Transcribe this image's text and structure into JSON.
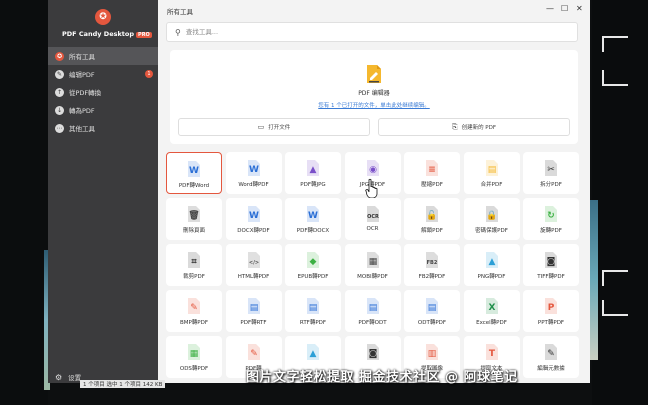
{
  "window": {
    "title": "所有工具"
  },
  "brand": {
    "name": "PDF Candy Desktop",
    "badge": "PRO"
  },
  "sidebar": {
    "items": [
      {
        "label": "所有工具",
        "icon": "brand-icon",
        "active": true
      },
      {
        "label": "编辑PDF",
        "icon": "edit-icon",
        "badge": "1"
      },
      {
        "label": "從PDF轉換",
        "icon": "convert-from-icon"
      },
      {
        "label": "轉為PDF",
        "icon": "convert-to-icon"
      },
      {
        "label": "其他工具",
        "icon": "more-icon"
      }
    ],
    "settings_label": "设置"
  },
  "search": {
    "placeholder": "查找工具..."
  },
  "editor": {
    "title": "PDF 编辑器",
    "link": "您有 1 个已打开的文件，单击此处继续编辑。",
    "open_label": "打开文件",
    "create_label": "创建新的 PDF"
  },
  "tools": [
    {
      "label": "PDF轉Word",
      "icon": "word",
      "selected": true
    },
    {
      "label": "Word轉PDF",
      "icon": "word"
    },
    {
      "label": "PDF轉JPG",
      "icon": "jpg"
    },
    {
      "label": "JPG轉PDF",
      "icon": "jpg2"
    },
    {
      "label": "壓縮PDF",
      "icon": "compress"
    },
    {
      "label": "合并PDF",
      "icon": "merge"
    },
    {
      "label": "拆分PDF",
      "icon": "scissors"
    },
    {
      "label": "刪除頁面",
      "icon": "trash"
    },
    {
      "label": "DOCX轉PDF",
      "icon": "word"
    },
    {
      "label": "PDF轉DOCX",
      "icon": "word"
    },
    {
      "label": "OCR",
      "icon": "ocr"
    },
    {
      "label": "解鎖PDF",
      "icon": "unlock"
    },
    {
      "label": "密碼保護PDF",
      "icon": "lock"
    },
    {
      "label": "旋轉PDF",
      "icon": "rotate"
    },
    {
      "label": "裁剪PDF",
      "icon": "crop"
    },
    {
      "label": "HTML轉PDF",
      "icon": "html"
    },
    {
      "label": "EPUB轉PDF",
      "icon": "epub"
    },
    {
      "label": "MOBI轉PDF",
      "icon": "mobi"
    },
    {
      "label": "FB2轉PDF",
      "icon": "fb2"
    },
    {
      "label": "PNG轉PDF",
      "icon": "png"
    },
    {
      "label": "TIFF轉PDF",
      "icon": "tiff"
    },
    {
      "label": "BMP轉PDF",
      "icon": "bmp"
    },
    {
      "label": "PDF轉RTF",
      "icon": "rtf"
    },
    {
      "label": "RTF轉PDF",
      "icon": "rtf"
    },
    {
      "label": "PDF轉ODT",
      "icon": "odt"
    },
    {
      "label": "ODT轉PDF",
      "icon": "odt"
    },
    {
      "label": "Excel轉PDF",
      "icon": "excel"
    },
    {
      "label": "PPT轉PDF",
      "icon": "ppt"
    },
    {
      "label": "ODS轉PDF",
      "icon": "ods"
    },
    {
      "label": "PDF轉",
      "icon": "bmp"
    },
    {
      "label": "",
      "icon": "image"
    },
    {
      "label": "",
      "icon": "camera"
    },
    {
      "label": "提取圖像",
      "icon": "extract-image"
    },
    {
      "label": "提取文本",
      "icon": "extract-text"
    },
    {
      "label": "編輯元數據",
      "icon": "metadata"
    }
  ],
  "status": {
    "text": "1 个项目    选中 1 个项目  142 KB"
  },
  "watermark": {
    "text": "图片文字轻松提取  掘金技术社区 @ 阿球笔记"
  },
  "colors": {
    "accent": "#e4573e",
    "sidebar": "#3b3b3d",
    "link": "#3a7bd5"
  }
}
